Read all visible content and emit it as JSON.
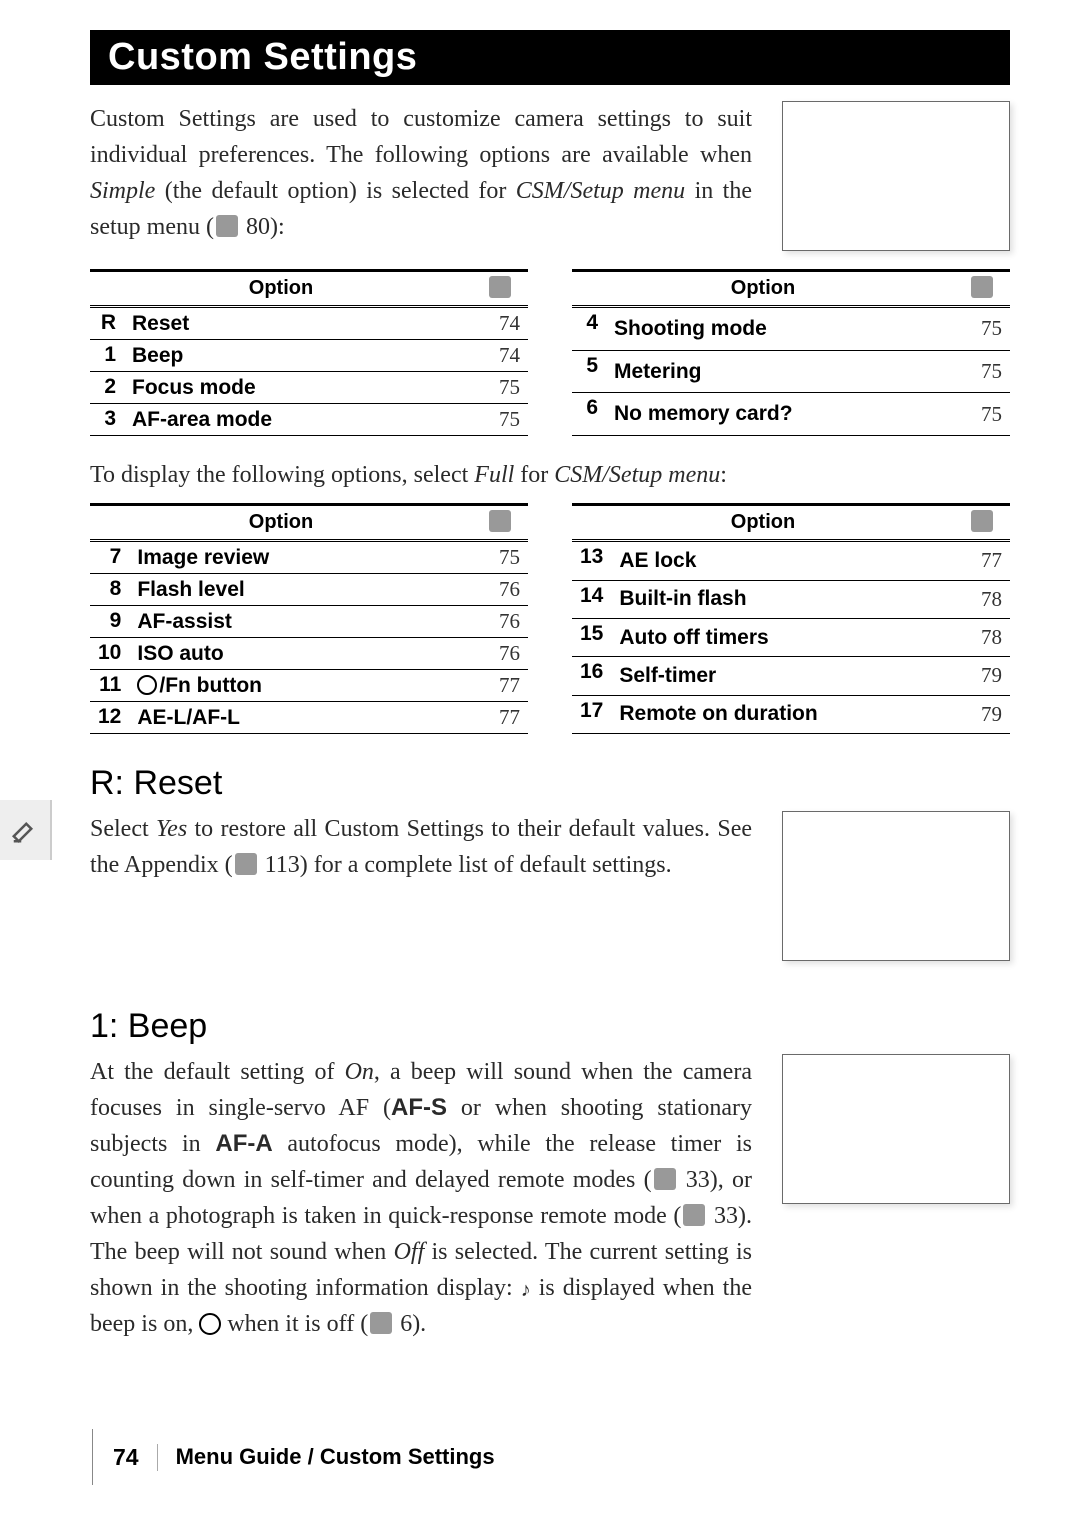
{
  "title": "Custom Settings",
  "intro_1a": "Custom Settings are used to customize camera settings to suit individual preferences.  The following options are available when ",
  "intro_simple": "Simple",
  "intro_1b": " (the default option) is selected for ",
  "intro_csm": "CSM/Setup menu",
  "intro_1c": " in the setup menu (",
  "intro_pg": " 80):",
  "table_hdr_option": "Option",
  "simple_left": [
    {
      "num": "R",
      "label": "Reset",
      "page": "74"
    },
    {
      "num": "1",
      "label": "Beep",
      "page": "74"
    },
    {
      "num": "2",
      "label": "Focus mode",
      "page": "75"
    },
    {
      "num": "3",
      "label": "AF-area mode",
      "page": "75"
    }
  ],
  "simple_right": [
    {
      "num": "4",
      "label": "Shooting mode",
      "page": "75"
    },
    {
      "num": "5",
      "label": "Metering",
      "page": "75"
    },
    {
      "num": "6",
      "label": "No memory card?",
      "page": "75"
    }
  ],
  "mid_1a": "To display the following options, select ",
  "mid_full": "Full",
  "mid_1b": " for ",
  "mid_csm": "CSM/Setup menu",
  "mid_1c": ":",
  "full_left": [
    {
      "num": "7",
      "label": "Image review",
      "page": "75"
    },
    {
      "num": "8",
      "label": "Flash level",
      "page": "76"
    },
    {
      "num": "9",
      "label": "AF-assist",
      "page": "76"
    },
    {
      "num": "10",
      "label": "ISO auto",
      "page": "76"
    },
    {
      "num": "11",
      "label": "⏱/Fn button",
      "page": "77",
      "timer": true
    },
    {
      "num": "12",
      "label": "AE-L/AF-L",
      "page": "77"
    }
  ],
  "full_right": [
    {
      "num": "13",
      "label": "AE lock",
      "page": "77"
    },
    {
      "num": "14",
      "label": "Built-in flash",
      "page": "78"
    },
    {
      "num": "15",
      "label": "Auto off timers",
      "page": "78"
    },
    {
      "num": "16",
      "label": "Self-timer",
      "page": "79"
    },
    {
      "num": "17",
      "label": "Remote on duration",
      "page": "79"
    }
  ],
  "reset_h": "R: Reset",
  "reset_1a": "Select ",
  "reset_yes": "Yes",
  "reset_1b": " to restore all Custom Settings to their default values.  See the Appendix (",
  "reset_pg": " 113) for a complete list of default settings.",
  "beep_h": "1: Beep",
  "beep_1a": "At the default setting of ",
  "beep_on": "On",
  "beep_1b": ", a beep will sound when the camera focuses in single-servo AF (",
  "beep_afs": "AF-S",
  "beep_1c": " or when shooting stationary subjects in ",
  "beep_afa": "AF-A",
  "beep_1d": " autofocus mode), while the release timer is counting down in self-timer and delayed remote modes (",
  "beep_p33a": " 33), or when a photograph is taken in quick-response remote mode (",
  "beep_p33b": " 33).  The beep will not sound when ",
  "beep_off": "Off",
  "beep_1e": " is selected.  The current setting is shown in the shooting information display: ",
  "beep_1f": " is displayed when the beep is on, ",
  "beep_1g": " when it is off (",
  "beep_p6": " 6).",
  "footer_page": "74",
  "footer_text": "Menu Guide / Custom Settings"
}
